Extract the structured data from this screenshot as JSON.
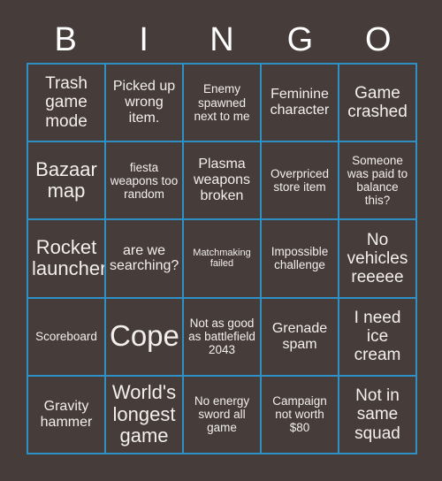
{
  "header": {
    "letters": [
      "B",
      "I",
      "N",
      "G",
      "O"
    ]
  },
  "colors": {
    "background": "#463c3a",
    "border": "#2f90c6",
    "text": "#f2efed",
    "header_text": "#ffffff"
  },
  "grid": {
    "columns": 5,
    "rows": 5,
    "cells": [
      {
        "text": "Trash game mode",
        "size": "lg"
      },
      {
        "text": "Picked up wrong item.",
        "size": "md"
      },
      {
        "text": "Enemy spawned next to me",
        "size": "sm"
      },
      {
        "text": "Feminine character",
        "size": "md"
      },
      {
        "text": "Game crashed",
        "size": "lg"
      },
      {
        "text": "Bazaar map",
        "size": "xl"
      },
      {
        "text": "fiesta weapons too random",
        "size": "sm"
      },
      {
        "text": "Plasma weapons broken",
        "size": "md"
      },
      {
        "text": "Overpriced store item",
        "size": "sm"
      },
      {
        "text": "Someone was paid to balance this?",
        "size": "sm"
      },
      {
        "text": "Rocket launcher",
        "size": "xl"
      },
      {
        "text": "are we searching?",
        "size": "md"
      },
      {
        "text": "Matchmaking failed",
        "size": "xs"
      },
      {
        "text": "Impossible challenge",
        "size": "sm"
      },
      {
        "text": "No vehicles reeeee",
        "size": "lg"
      },
      {
        "text": "Scoreboard",
        "size": "sm"
      },
      {
        "text": "Cope",
        "size": "xxl"
      },
      {
        "text": "Not as good as battlefield 2043",
        "size": "sm"
      },
      {
        "text": "Grenade spam",
        "size": "md"
      },
      {
        "text": "I need ice cream",
        "size": "lg"
      },
      {
        "text": "Gravity hammer",
        "size": "md"
      },
      {
        "text": "World's longest game",
        "size": "xl"
      },
      {
        "text": "No energy sword all game",
        "size": "sm"
      },
      {
        "text": "Campaign not worth $80",
        "size": "sm"
      },
      {
        "text": "Not in same squad",
        "size": "lg"
      }
    ]
  }
}
